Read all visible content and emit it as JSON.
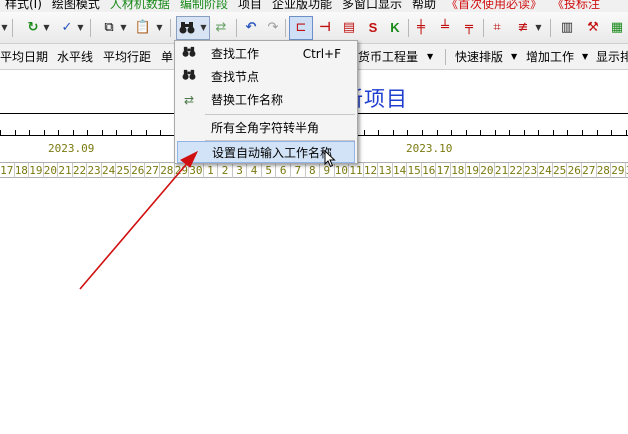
{
  "menu_bar": {
    "items": [
      {
        "label": "样式(I)"
      },
      {
        "label": "绘图模式"
      },
      {
        "label": "人材机数据"
      },
      {
        "label": "编制阶段"
      },
      {
        "label": "项目"
      },
      {
        "label": "企业版功能"
      },
      {
        "label": "多窗口显示"
      },
      {
        "label": "帮助"
      },
      {
        "label": "《首次使用必读》"
      },
      {
        "label": "《投标注"
      }
    ]
  },
  "toolbar2": {
    "avg_date": "平均日期",
    "horizontal_line": "水平线",
    "avg_row_spacing": "平均行距",
    "single": "单",
    "currency_quantity": "货币工程量",
    "quick_layout": "快速排版",
    "add_work": "增加工作",
    "display": "显示排"
  },
  "chart": {
    "project_title": "新项目",
    "months": [
      "2023.09",
      "2023.10"
    ],
    "days_sep": [
      "17",
      "18",
      "19",
      "20",
      "21",
      "22",
      "23",
      "24",
      "25",
      "26",
      "27",
      "28",
      "29",
      "30"
    ],
    "days_oct": [
      "1",
      "2",
      "3",
      "4",
      "5",
      "6",
      "7",
      "8",
      "9",
      "10",
      "11",
      "12",
      "13",
      "14",
      "15",
      "16",
      "17",
      "18",
      "19",
      "20",
      "21",
      "22",
      "23",
      "24",
      "25",
      "26",
      "27",
      "28",
      "29",
      "30"
    ]
  },
  "find_menu": {
    "items": [
      {
        "label": "查找工作",
        "shortcut": "Ctrl+F",
        "icon": "binoculars-icon"
      },
      {
        "label": "查找节点",
        "shortcut": "",
        "icon": "binoculars-icon"
      },
      {
        "label": "替换工作名称",
        "shortcut": "",
        "icon": "replace-icon"
      },
      {
        "label": "所有全角字符转半角",
        "shortcut": "",
        "icon": ""
      },
      {
        "label": "设置自动输入工作名称",
        "shortcut": "",
        "icon": ""
      }
    ]
  },
  "colors": {
    "accent_blue": "#1f3fd0",
    "date_text": "#7a7a10",
    "menu_highlight": "#d2e3f7",
    "arrow_red": "#d01010"
  }
}
